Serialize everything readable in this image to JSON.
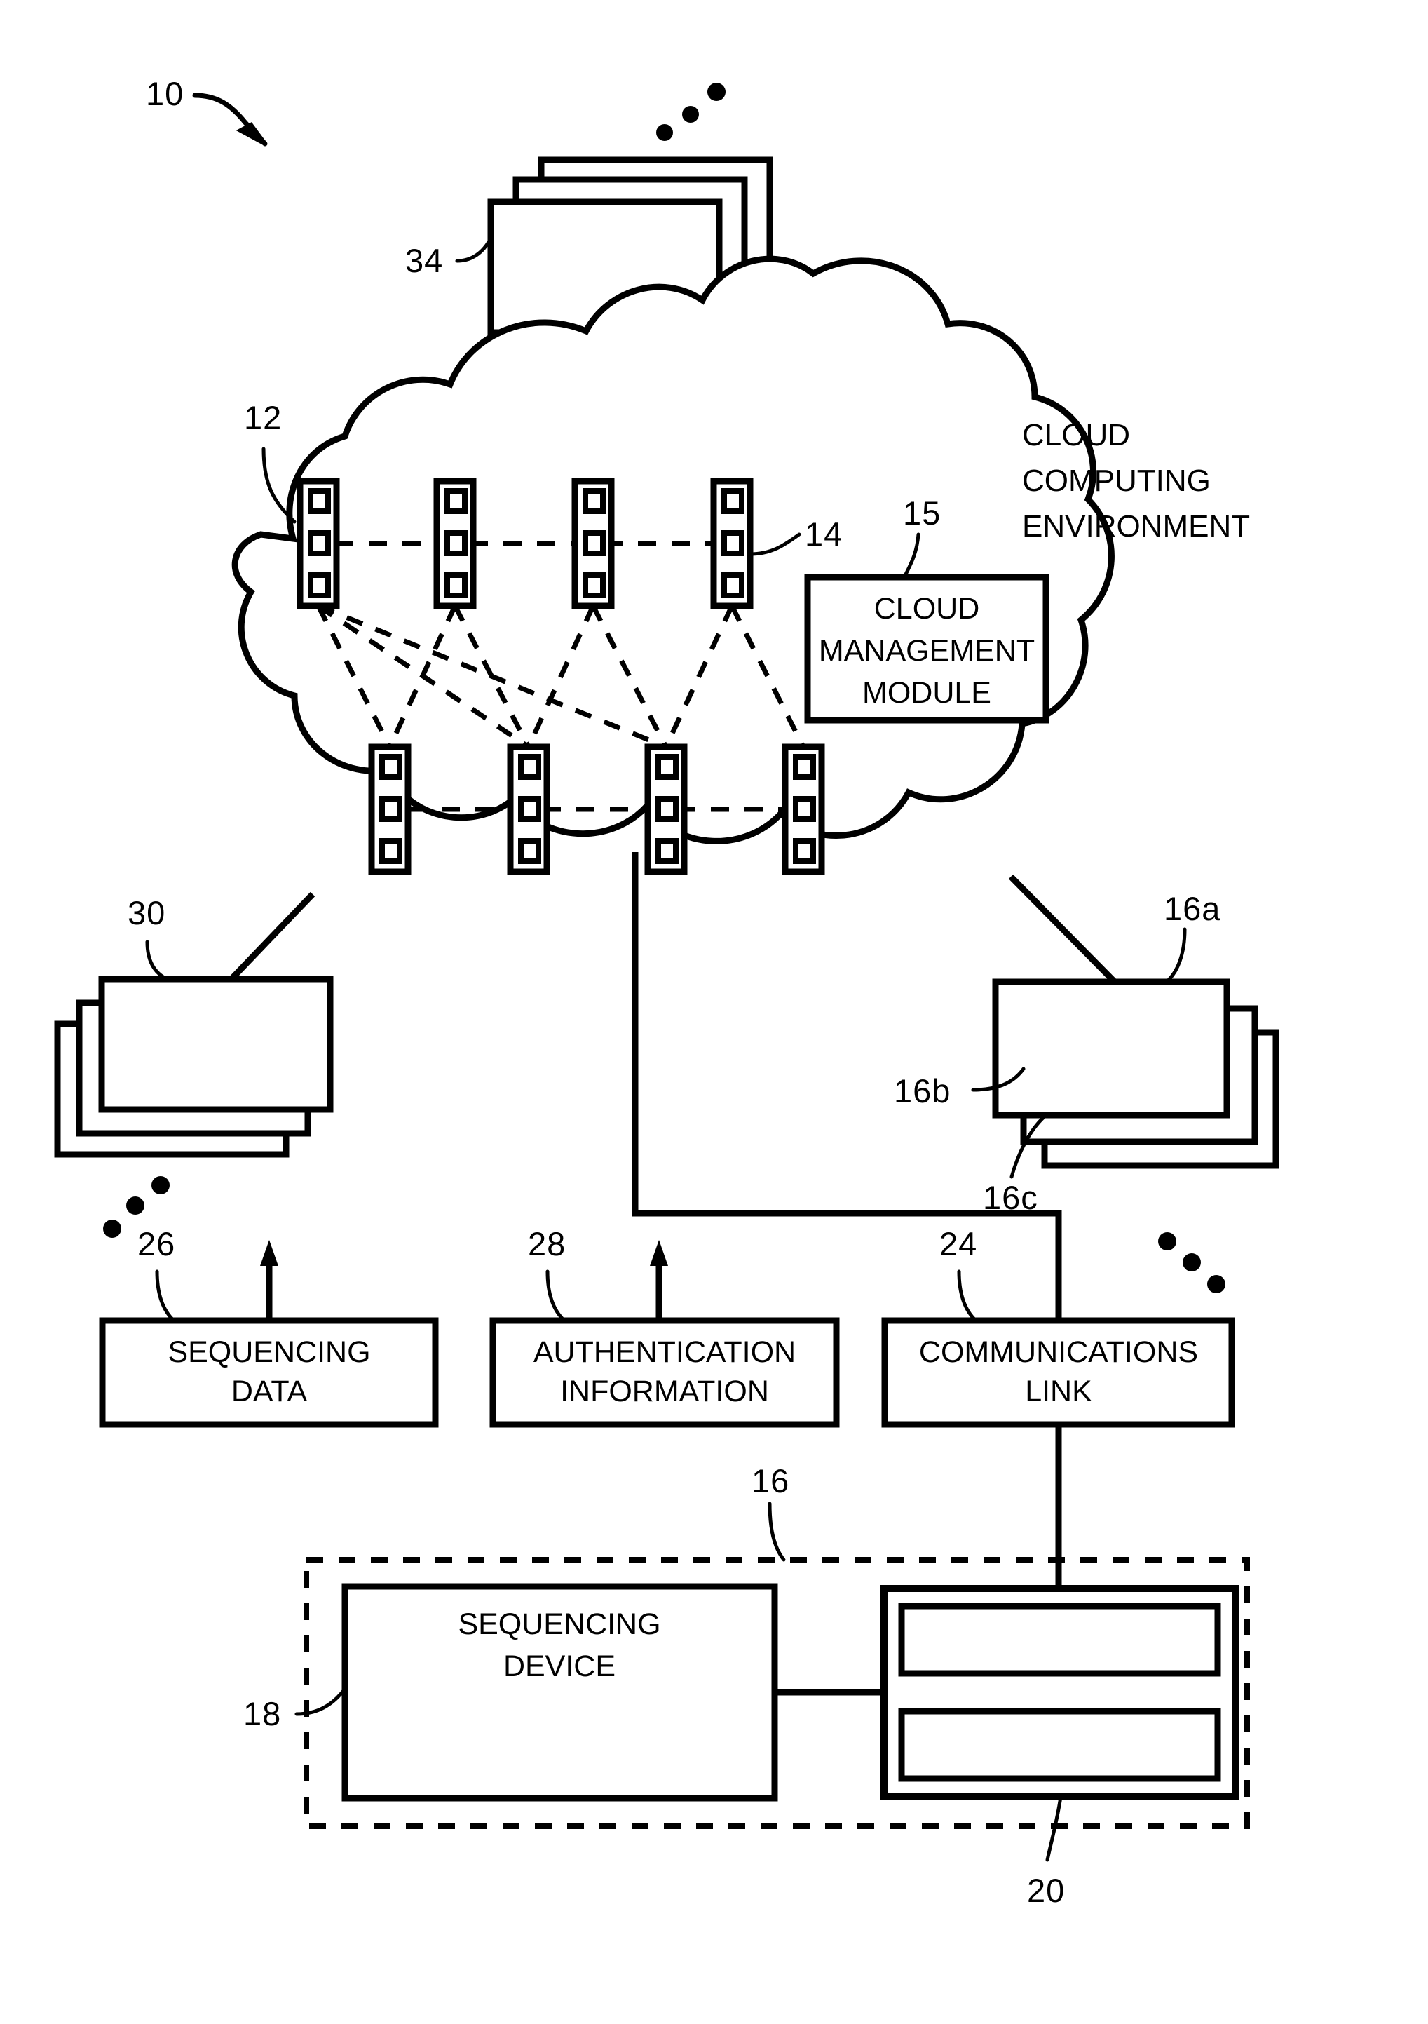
{
  "figure": {
    "title": "Cloud-based sequencing system block diagram",
    "reference_numerals": {
      "system": "10",
      "cloud": "12",
      "server_node": "14",
      "cloud_management_module": "15",
      "client_group": "16",
      "client_a": "16a",
      "client_b": "16b",
      "client_c": "16c",
      "sequencing_device": "18",
      "computing_device": "20",
      "communications_link": "24",
      "sequencing_data": "26",
      "authentication_information": "28",
      "remote_devices": "30",
      "top_devices": "34"
    },
    "labels": {
      "cloud_environment_line1": "CLOUD",
      "cloud_environment_line2": "COMPUTING",
      "cloud_environment_line3": "ENVIRONMENT",
      "cloud_management_line1": "CLOUD",
      "cloud_management_line2": "MANAGEMENT",
      "cloud_management_line3": "MODULE",
      "sequencing_data_line1": "SEQUENCING",
      "sequencing_data_line2": "DATA",
      "authentication_line1": "AUTHENTICATION",
      "authentication_line2": "INFORMATION",
      "communications_line1": "COMMUNICATIONS",
      "communications_line2": "LINK",
      "sequencing_device_line1": "SEQUENCING",
      "sequencing_device_line2": "DEVICE"
    },
    "colors": {
      "ink": "#000000",
      "paper": "#ffffff"
    }
  }
}
